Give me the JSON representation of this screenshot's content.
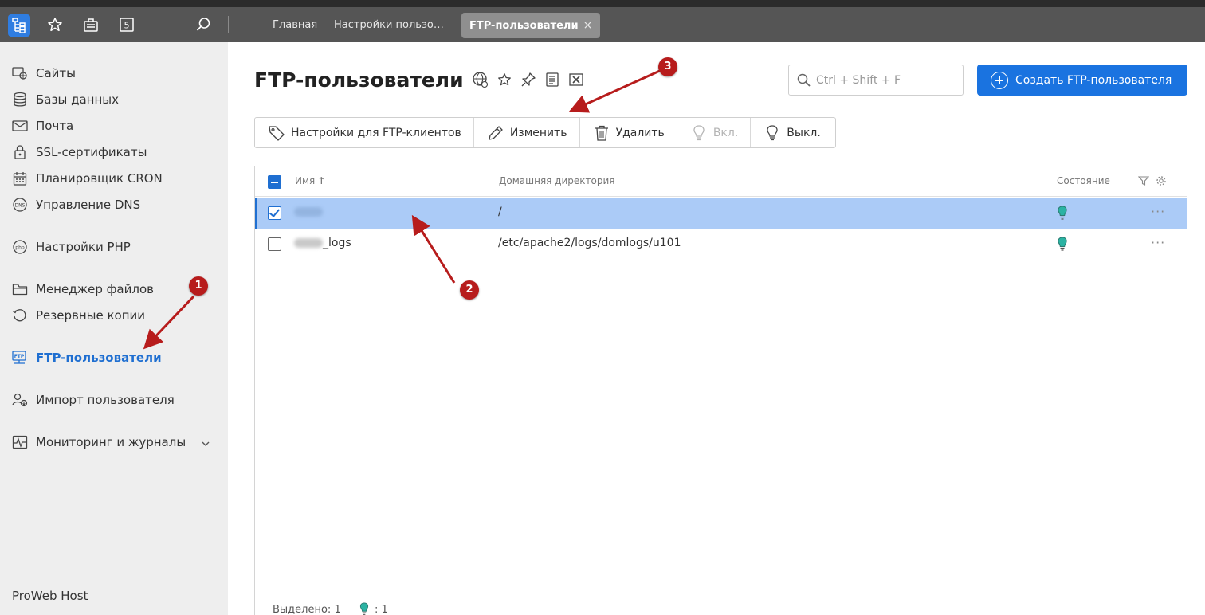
{
  "header": {
    "tabs": [
      {
        "label": "Главная"
      },
      {
        "label": "Настройки пользо…"
      },
      {
        "label": "FTP-пользователи",
        "close": "×"
      }
    ],
    "badge_number": "5"
  },
  "sidebar": {
    "items": [
      {
        "label": "Сайты",
        "icon": "sites-icon"
      },
      {
        "label": "Базы данных",
        "icon": "database-icon"
      },
      {
        "label": "Почта",
        "icon": "mail-icon"
      },
      {
        "label": "SSL-сертификаты",
        "icon": "lock-icon"
      },
      {
        "label": "Планировщик CRON",
        "icon": "calendar-icon"
      },
      {
        "label": "Управление DNS",
        "icon": "dns-icon"
      },
      {
        "label": "Настройки PHP",
        "icon": "php-icon"
      },
      {
        "label": "Менеджер файлов",
        "icon": "folder-icon"
      },
      {
        "label": "Резервные копии",
        "icon": "backup-icon"
      },
      {
        "label": "FTP-пользователи",
        "icon": "ftp-icon"
      },
      {
        "label": "Импорт пользователя",
        "icon": "user-import-icon"
      },
      {
        "label": "Мониторинг и журналы",
        "icon": "monitoring-icon"
      }
    ],
    "footer_link": "ProWeb Host"
  },
  "main": {
    "title": "FTP-пользователи",
    "search_placeholder": "Ctrl + Shift + F",
    "create_button": "Создать FTP-пользователя",
    "toolbar": {
      "ftp_settings": "Настройки для FTP-клиентов",
      "edit": "Изменить",
      "delete": "Удалить",
      "enable": "Вкл.",
      "disable": "Выкл."
    },
    "table": {
      "columns": {
        "name": "Имя",
        "sort_indicator": "↑",
        "home_dir": "Домашняя директория",
        "state": "Состояние"
      },
      "rows": [
        {
          "name_suffix": "",
          "home_dir": "/",
          "selected": true
        },
        {
          "name_suffix": "_logs",
          "home_dir": "/etc/apache2/logs/domlogs/u101",
          "selected": false
        }
      ],
      "more": "···"
    },
    "footer": {
      "selected": "Выделено: 1",
      "active_count": ": 1"
    }
  },
  "annotations": {
    "m1": "1",
    "m2": "2",
    "m3": "3"
  },
  "colors": {
    "accent": "#1a73e0",
    "selected_row": "#abcbf7",
    "annotation": "#b71c1c",
    "status_on": "#2bb3a3"
  }
}
